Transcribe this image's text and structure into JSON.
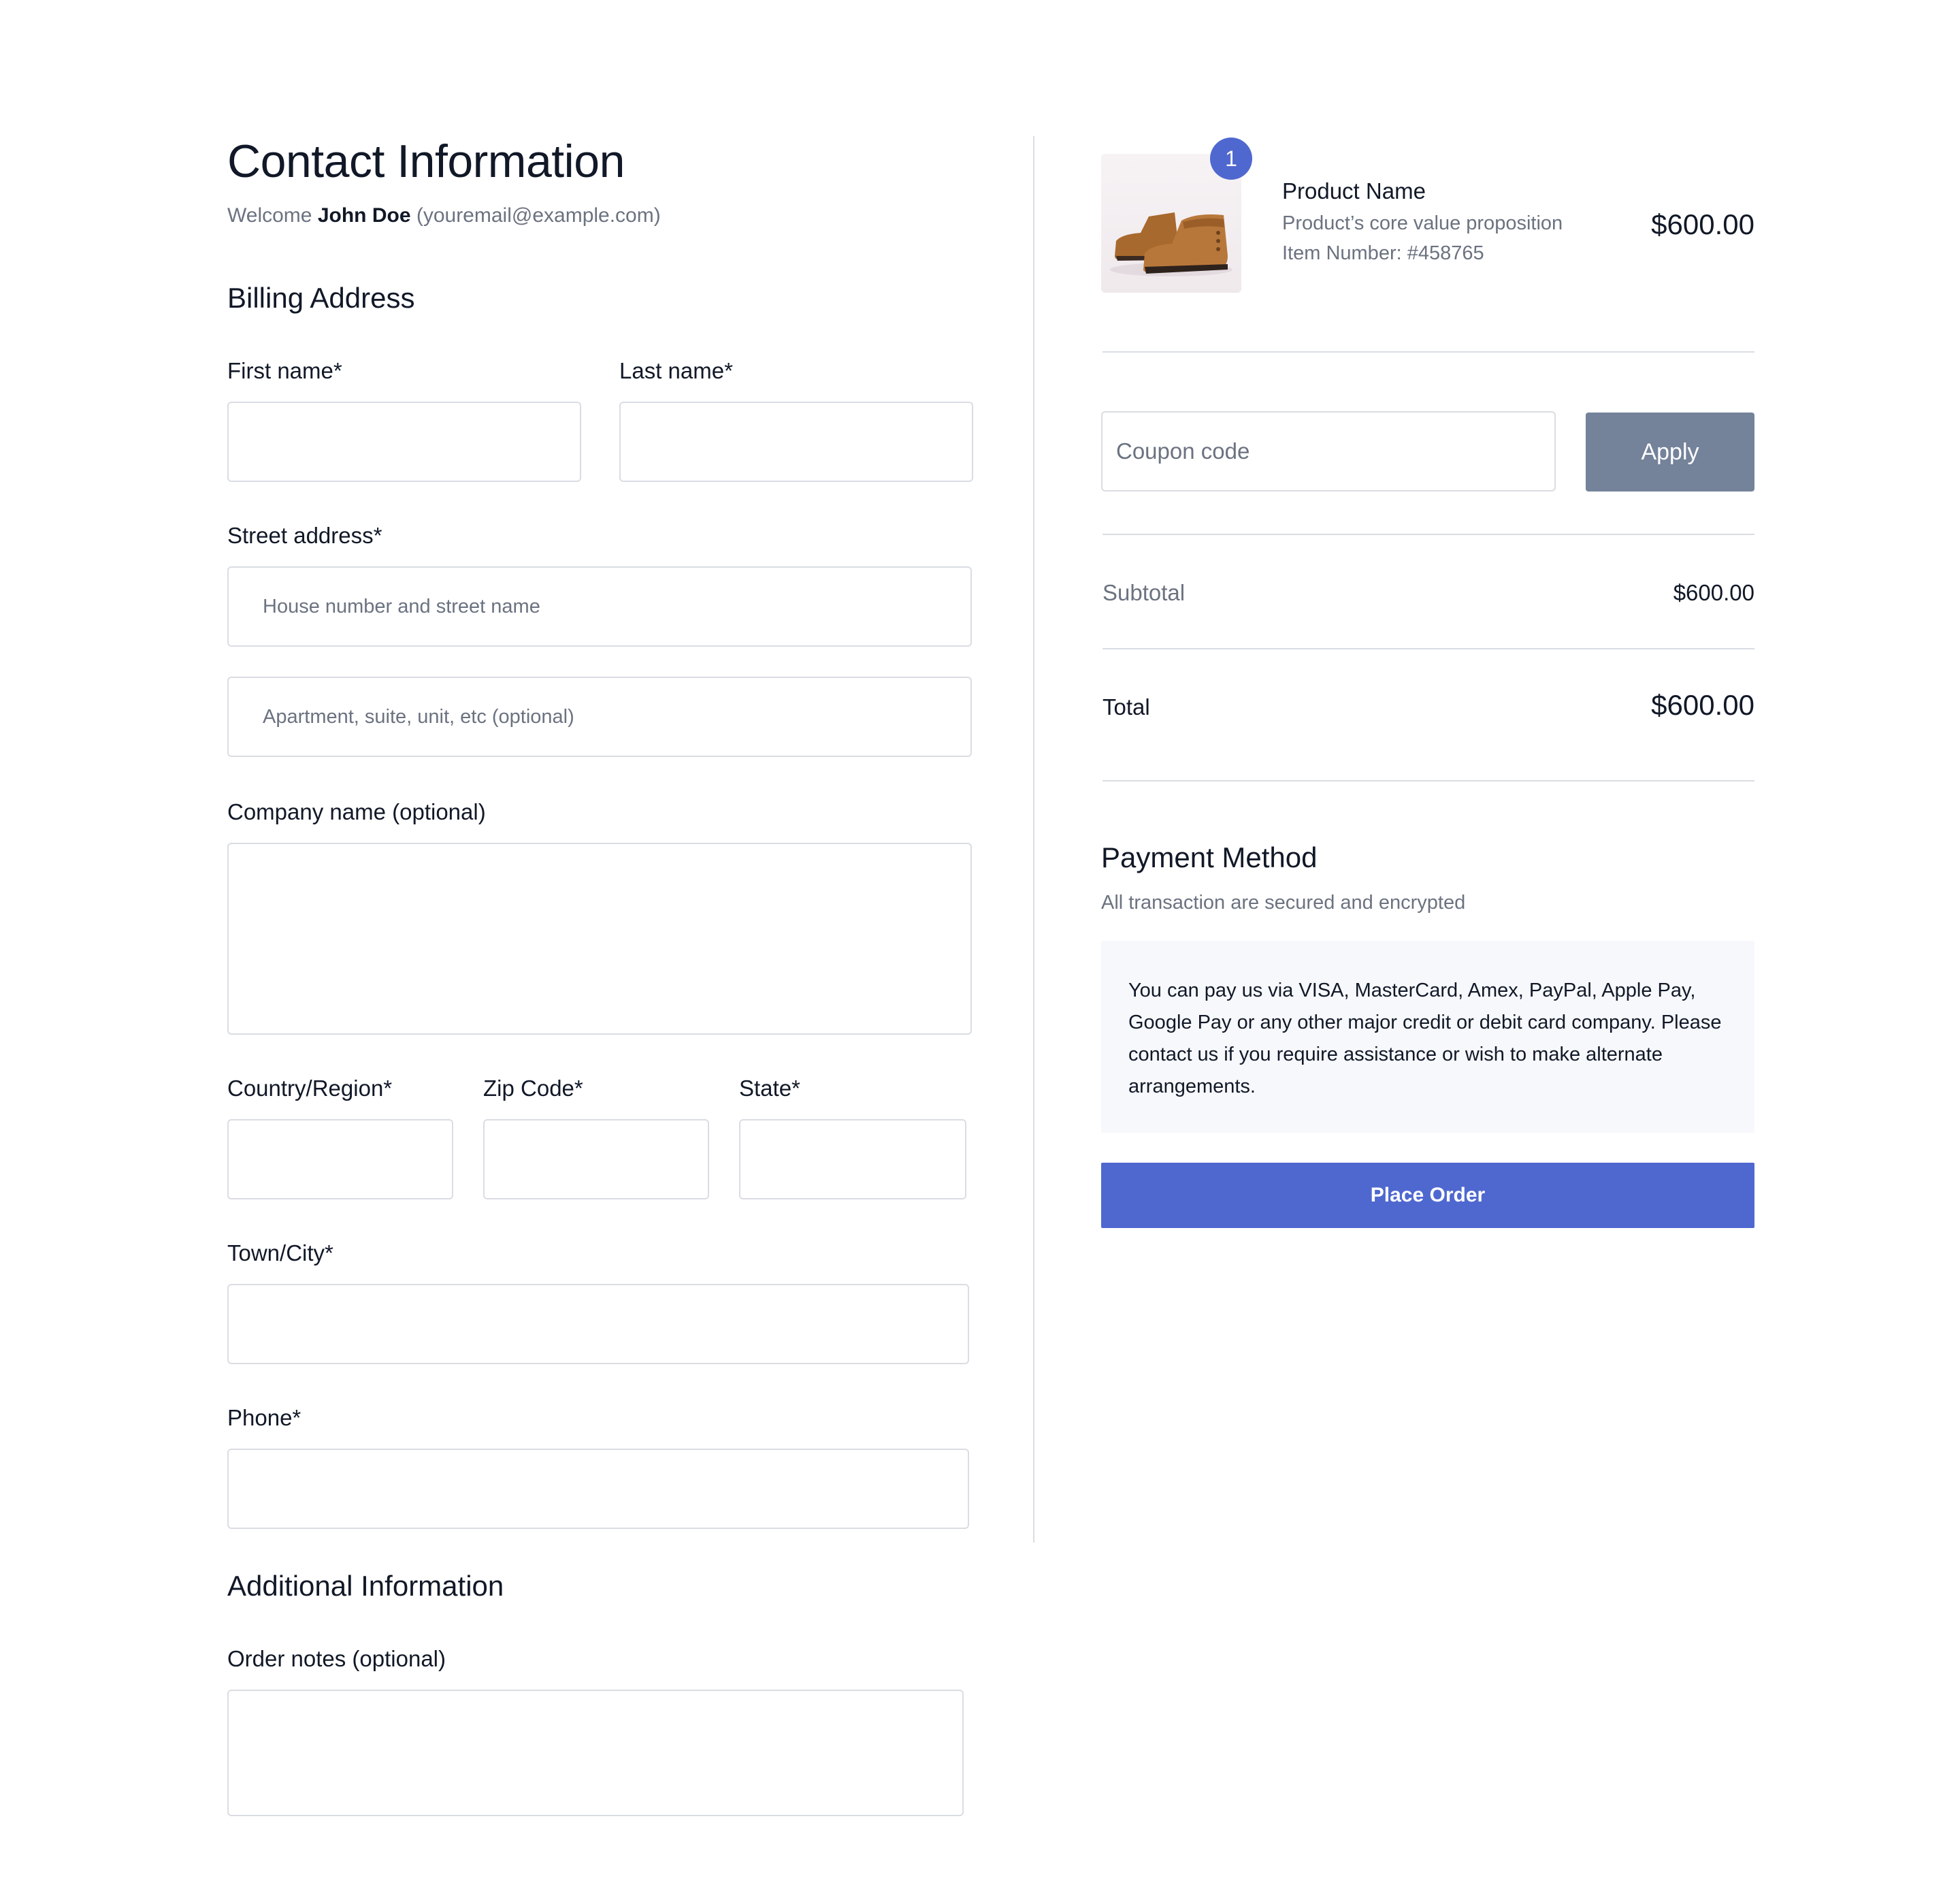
{
  "contact": {
    "title": "Contact Information",
    "welcome_prefix": "Welcome ",
    "user_name": "John Doe",
    "user_email": " (youremail@example.com)"
  },
  "billing": {
    "title": "Billing Address",
    "first_name_label": "First name*",
    "last_name_label": "Last name*",
    "street_label": "Street address*",
    "street_placeholder": "House number and street name",
    "apartment_placeholder": "Apartment, suite, unit, etc (optional)",
    "company_label": "Company name (optional)",
    "country_label": "Country/Region*",
    "zip_label": "Zip Code*",
    "state_label": "State*",
    "city_label": "Town/City*",
    "phone_label": "Phone*"
  },
  "additional": {
    "title": "Additional Information",
    "notes_label": "Order notes (optional)"
  },
  "product": {
    "quantity": "1",
    "name": "Product Name",
    "description": "Product’s core value proposition",
    "item_number": "Item Number: #458765",
    "price": "$600.00",
    "image_icon": "boot-image"
  },
  "coupon": {
    "placeholder": "Coupon code",
    "apply_label": "Apply"
  },
  "summary": {
    "subtotal_label": "Subtotal",
    "subtotal_value": "$600.00",
    "total_label": "Total",
    "total_value": "$600.00"
  },
  "payment": {
    "title": "Payment Method",
    "subtitle": "All transaction are secured and encrypted",
    "info": "You can pay us via VISA, MasterCard, Amex, PayPal, Apple Pay, Google Pay or any other major credit or debit card company. Please contact us if you require assistance or wish to make alternate arrangements.",
    "place_order_label": "Place Order"
  },
  "colors": {
    "accent": "#4f68d0",
    "apply_button": "#74829a",
    "border": "#d9dde3",
    "muted_text": "#6b7280",
    "info_box": "#f6f8fb"
  }
}
